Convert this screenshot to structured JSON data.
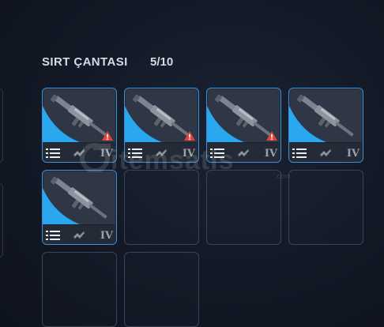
{
  "inventory": {
    "title": "SIRT ÇANTASI",
    "capacity_text": "5/10"
  },
  "slots": [
    {
      "filled": true,
      "tier": "IV",
      "warning": true,
      "item_icon": "rifle-icon"
    },
    {
      "filled": true,
      "tier": "IV",
      "warning": true,
      "item_icon": "rifle-icon"
    },
    {
      "filled": true,
      "tier": "IV",
      "warning": true,
      "item_icon": "rifle-icon"
    },
    {
      "filled": true,
      "tier": "IV",
      "warning": false,
      "item_icon": "rifle-icon"
    },
    {
      "filled": true,
      "tier": "IV",
      "warning": false,
      "item_icon": "rifle-icon"
    },
    {
      "filled": false
    },
    {
      "filled": false
    },
    {
      "filled": false
    },
    {
      "filled": false
    },
    {
      "filled": false
    }
  ],
  "watermark": {
    "text": "itemsatis",
    "domain": ".com"
  },
  "colors": {
    "accent_blue": "#29a8f0",
    "slot_border": "#3d8fd8",
    "warning_red": "#e0443c"
  }
}
